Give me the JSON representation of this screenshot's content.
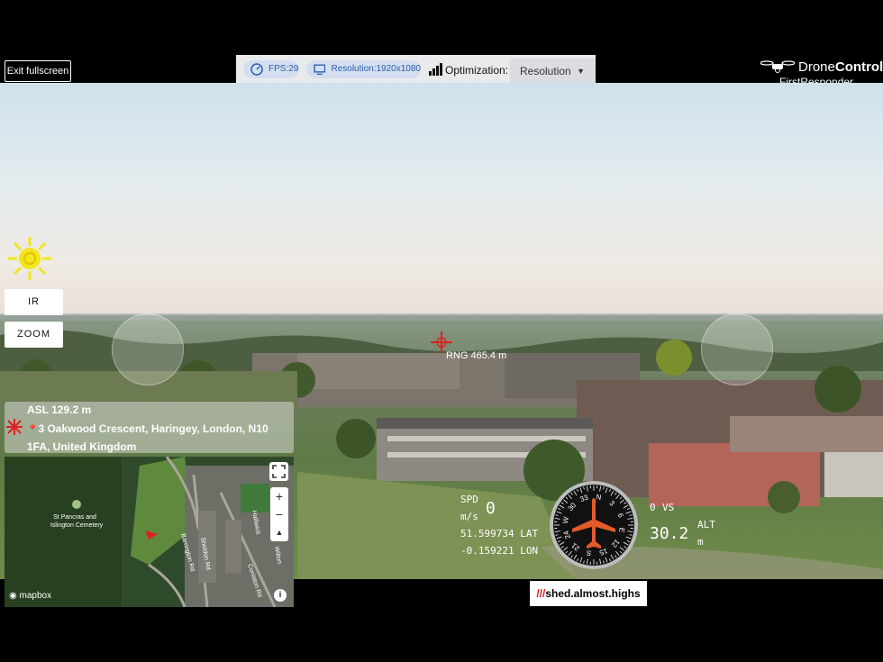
{
  "topbar": {
    "exit_label": "Exit fullscreen",
    "fps": "FPS:29",
    "resolution": "Resolution:1920x1080",
    "optimization_label": "Optimization:",
    "optimization_value": "Resolution"
  },
  "logo": {
    "brand_light": "Drone",
    "brand_bold": "Control",
    "sub": "FirstResponder"
  },
  "side": {
    "ir_label": "IR",
    "zoom_label": "ZOOM"
  },
  "hud": {
    "range": "RNG 465.4 m",
    "spd_label": "SPD",
    "spd_unit": "m/s",
    "spd_value": "0",
    "lat": "51.599734 LAT",
    "lon": "-0.159221 LON",
    "vs_value": "0",
    "vs_label": "VS",
    "alt_value": "30.2",
    "alt_label": "ALT",
    "alt_unit": "m"
  },
  "info": {
    "asl": "ASL 129.2 m",
    "address": "3 Oakwood Crescent, Haringey, London, N10 1FA, United Kingdom"
  },
  "map": {
    "cemetery_line1": "St Pancras and",
    "cemetery_line2": "Islington Cemetery",
    "road1": "Barrington Rd",
    "road2": "Sheldon Rd",
    "road3": "Coniston Rd",
    "road4": "Halliwick",
    "road5": "Wilton",
    "attribution": "mapbox",
    "zoom_in": "+",
    "zoom_out": "−"
  },
  "w3w": {
    "slashes": "///",
    "words": "shed.almost.highs"
  },
  "compass": {
    "heading_deg": 350,
    "labels": [
      "N",
      "3",
      "6",
      "E",
      "12",
      "15",
      "S",
      "21",
      "24",
      "W",
      "30",
      "33"
    ]
  },
  "colors": {
    "accent_blue": "#2a5db0",
    "w3w_red": "#e11f26",
    "sun_yellow": "#f2e61e",
    "drone_red": "#e02020"
  }
}
